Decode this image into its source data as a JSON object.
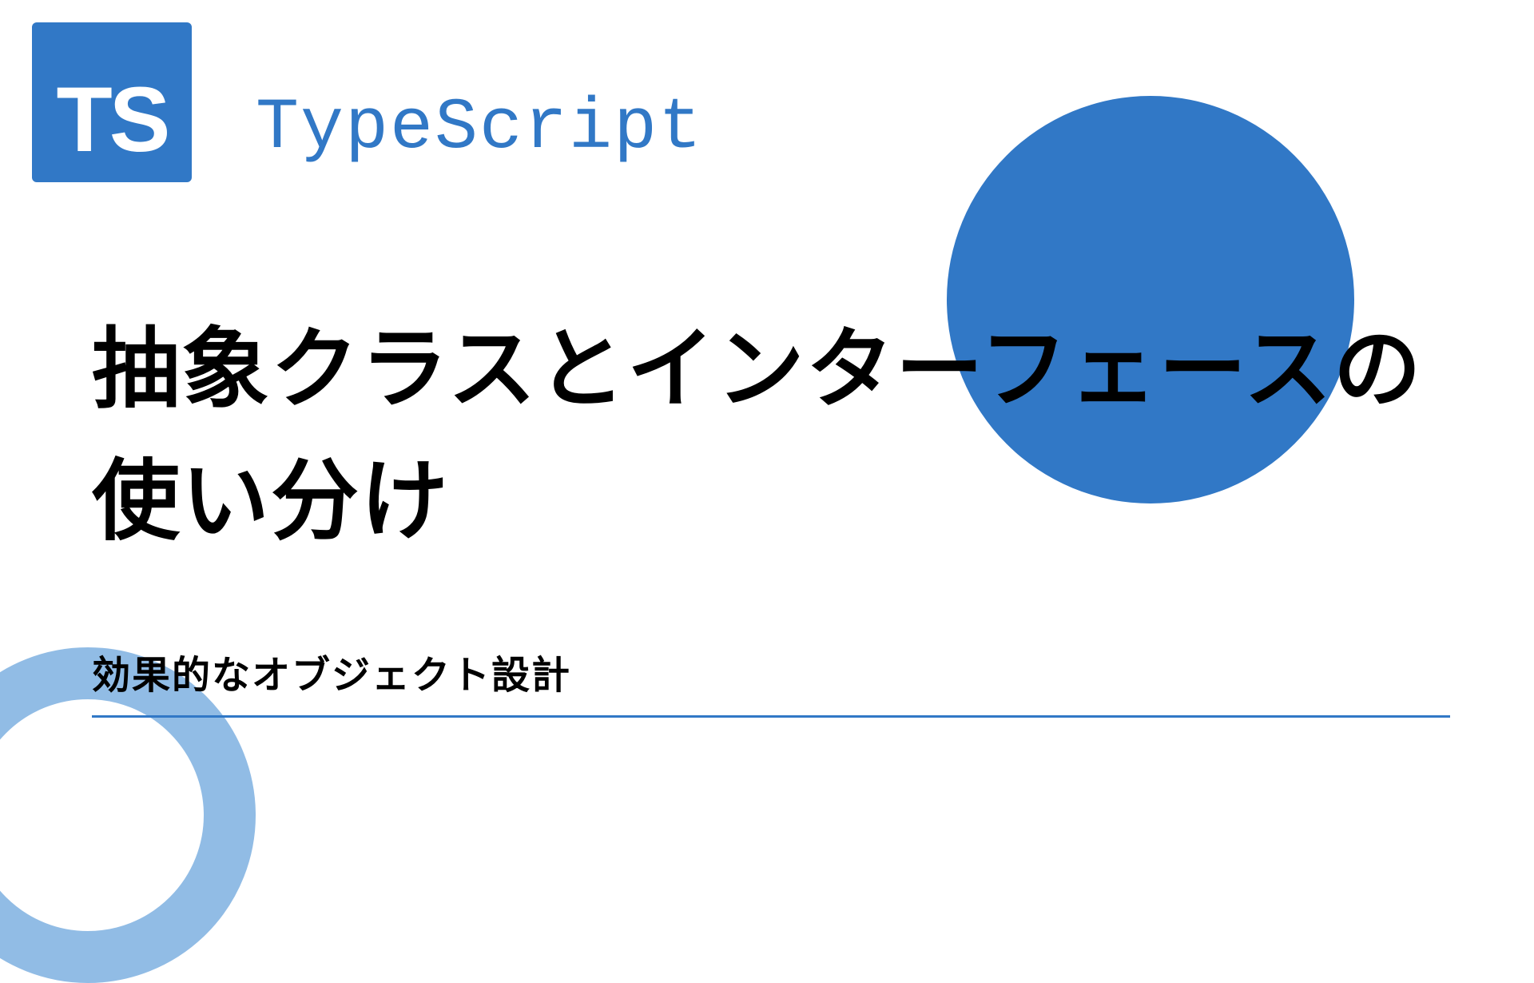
{
  "logo": {
    "text": "TS"
  },
  "header": {
    "label": "TypeScript"
  },
  "main": {
    "title": "抽象クラスとインターフェースの使い分け",
    "subtitle": "効果的なオブジェクト設計"
  },
  "colors": {
    "primary": "#3178c6",
    "ring": "#7eb0e0"
  }
}
